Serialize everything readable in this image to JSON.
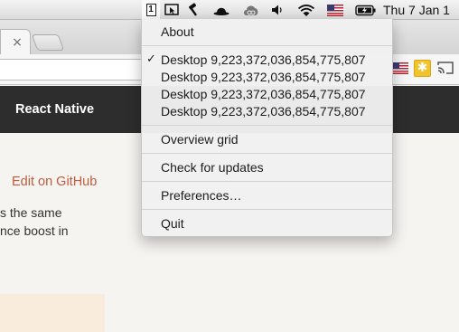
{
  "menubar": {
    "desktop_number": "1",
    "clock": "Thu 7 Jan  1"
  },
  "browser": {
    "tab_close_glyph": "×",
    "extension_star_glyph": "✱"
  },
  "site": {
    "brand": "React Native",
    "edit_link": "Edit on GitHub",
    "body_line_1": "s the same",
    "body_line_2": "nce boost in"
  },
  "menu": {
    "about": "About",
    "check_glyph": "✓",
    "desktops": [
      "Desktop 9,223,372,036,854,775,807",
      "Desktop 9,223,372,036,854,775,807",
      "Desktop 9,223,372,036,854,775,807",
      "Desktop 9,223,372,036,854,775,807"
    ],
    "overview_grid": "Overview grid",
    "check_updates": "Check for updates",
    "preferences": "Preferences…",
    "quit": "Quit"
  },
  "colors": {
    "accent_link": "#c05b3c",
    "nav_background": "#2d2d2d",
    "menu_selection_underline": "#3a7fe0"
  }
}
